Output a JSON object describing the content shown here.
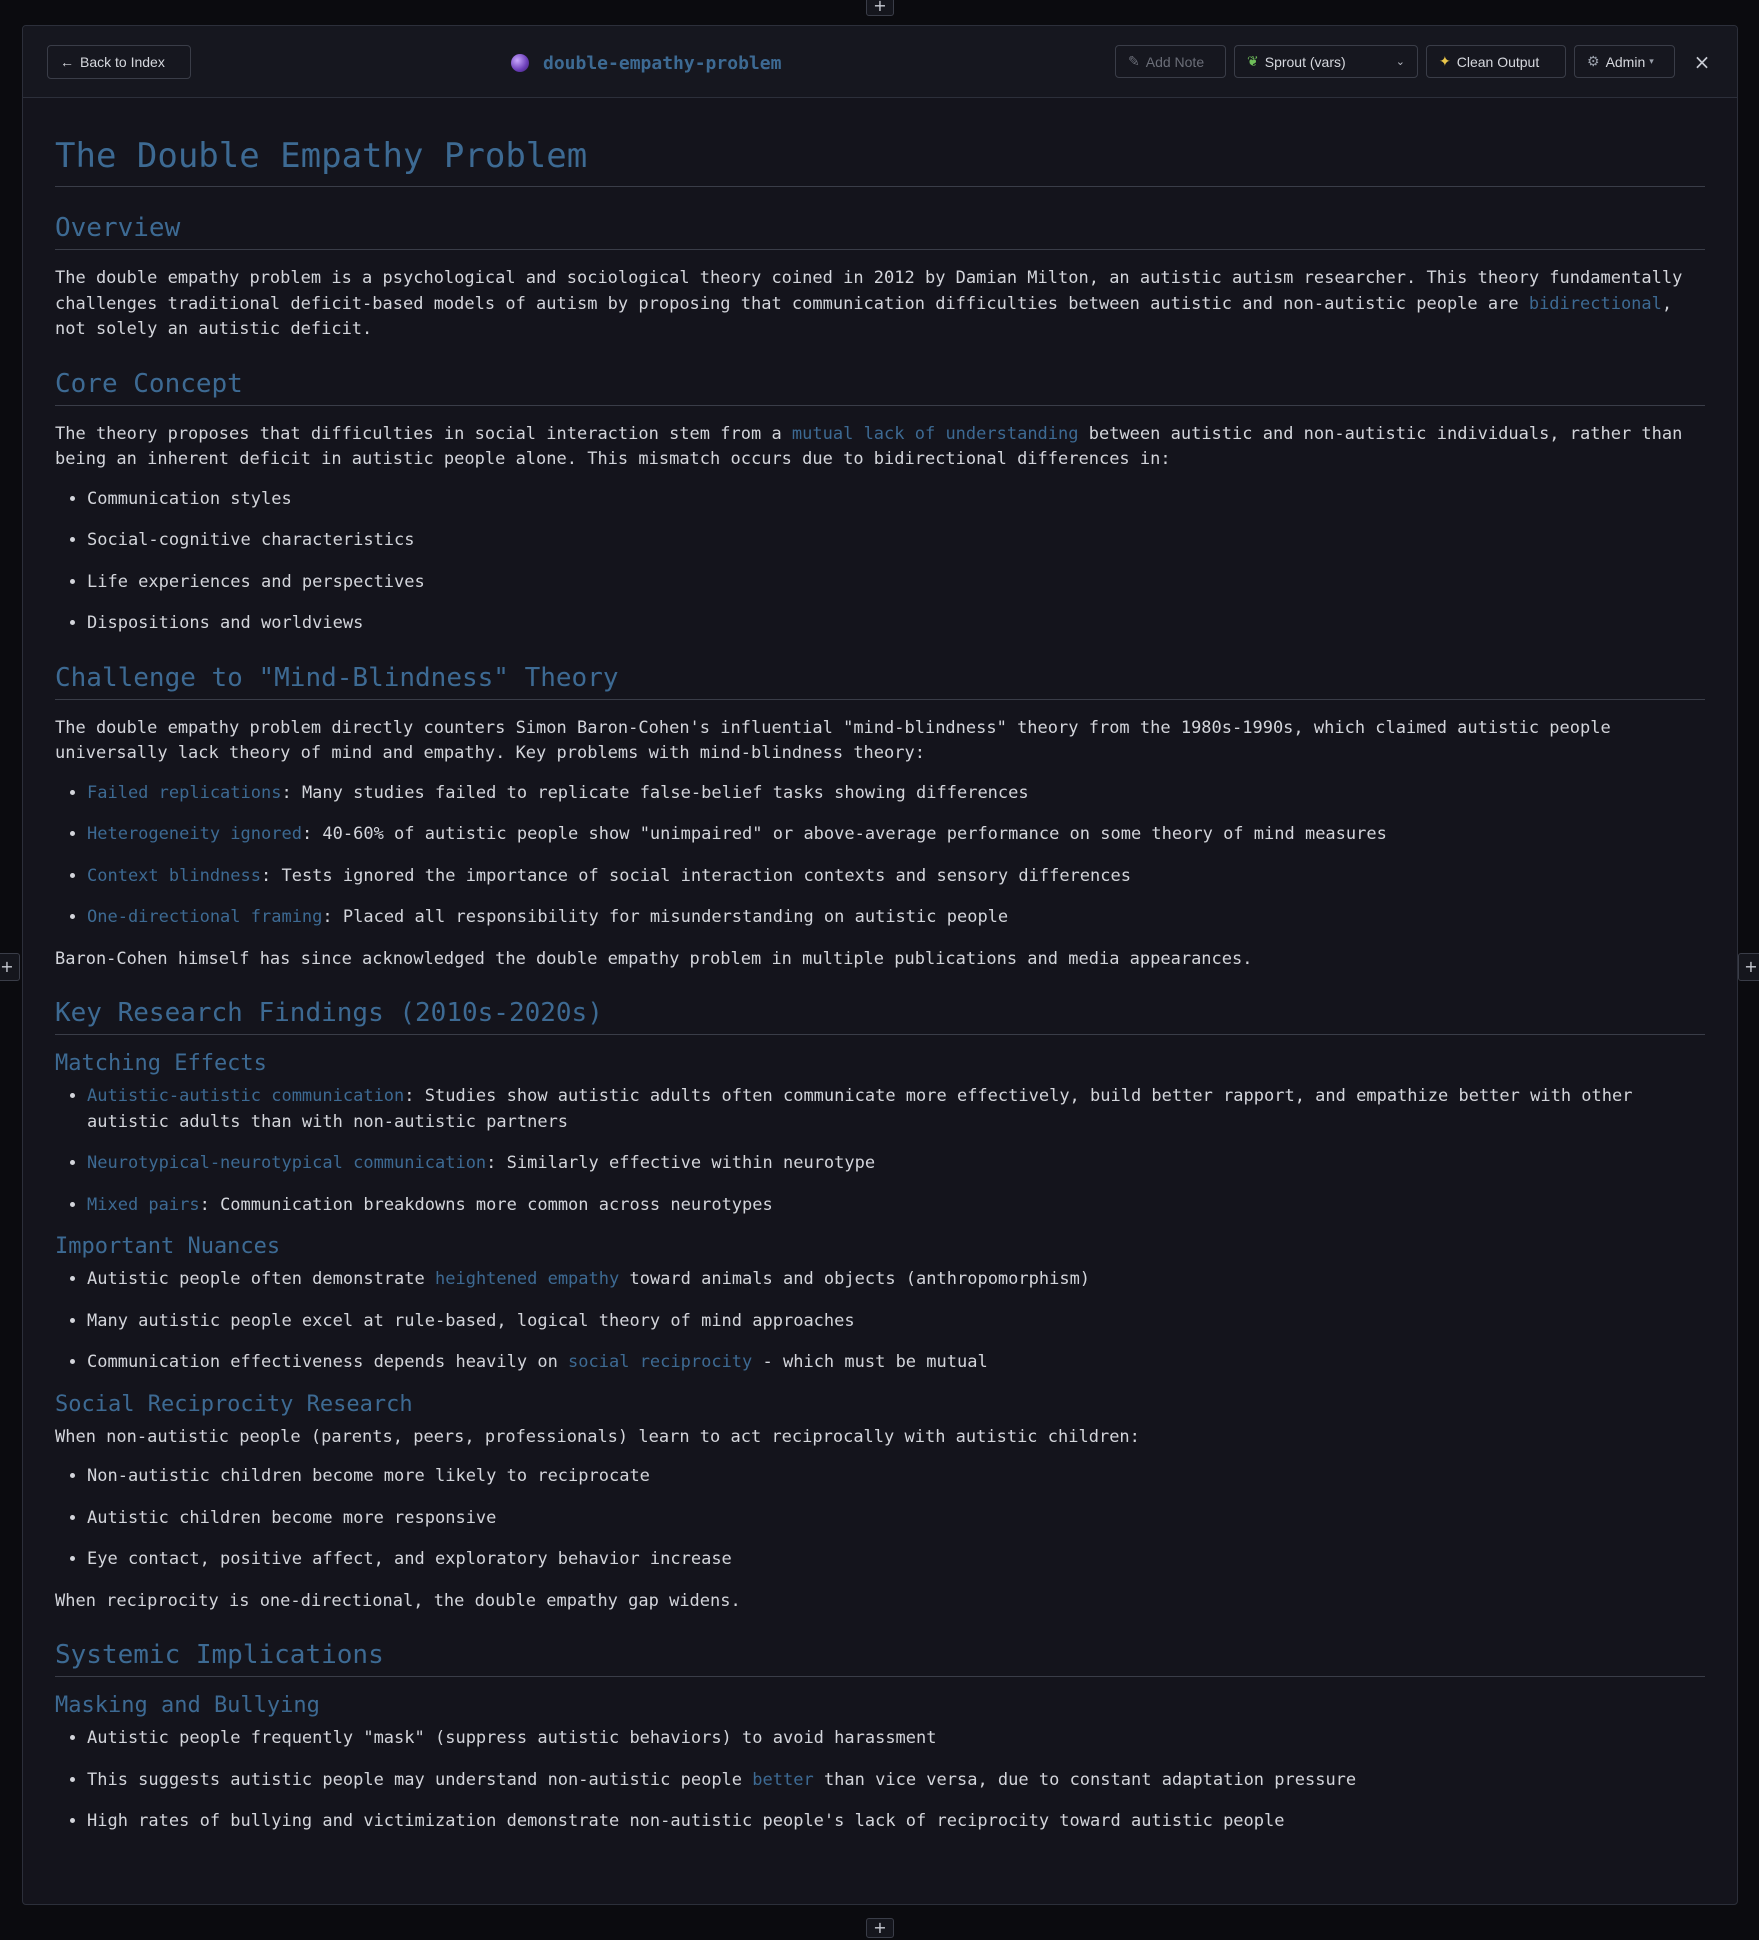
{
  "header": {
    "back_label": "Back to Index",
    "doc_title": "double-empathy-problem",
    "add_note_label": "Add Note",
    "sprout_value": "Sprout (vars)",
    "clean_label": "Clean Output",
    "admin_label": "Admin",
    "close_label": "×"
  },
  "icons": {
    "back": "arrow-left-icon",
    "orb": "crystal-ball-icon",
    "note": "memo-icon",
    "sprout": "seedling-icon",
    "clean": "sparkles-icon",
    "admin": "gear-icon"
  },
  "colors": {
    "background": "#14141c",
    "accent": "#3d6a93",
    "text": "#d3d5db"
  },
  "doc": {
    "h1": "The Double Empathy Problem",
    "overview": {
      "heading": "Overview",
      "p1_a": "The double empathy problem is a psychological and sociological theory coined in 2012 by Damian Milton, an autistic autism researcher. This theory fundamentally challenges traditional deficit-based models of autism by proposing that communication difficulties between autistic and non-autistic people are ",
      "p1_hl": "bidirectional",
      "p1_b": ", not solely an autistic deficit."
    },
    "core": {
      "heading": "Core Concept",
      "p1_a": "The theory proposes that difficulties in social interaction stem from a ",
      "p1_hl": "mutual lack of understanding",
      "p1_b": " between autistic and non-autistic individuals, rather than being an inherent deficit in autistic people alone. This mismatch occurs due to bidirectional differences in:",
      "items": [
        "Communication styles",
        "Social-cognitive characteristics",
        "Life experiences and perspectives",
        "Dispositions and worldviews"
      ]
    },
    "challenge": {
      "heading": "Challenge to \"Mind-Blindness\" Theory",
      "p1": "The double empathy problem directly counters Simon Baron-Cohen's influential \"mind-blindness\" theory from the 1980s-1990s, which claimed autistic people universally lack theory of mind and empathy. Key problems with mind-blindness theory:",
      "items": [
        {
          "term": "Failed replications",
          "text": ": Many studies failed to replicate false-belief tasks showing differences"
        },
        {
          "term": "Heterogeneity ignored",
          "text": ": 40-60% of autistic people show \"unimpaired\" or above-average performance on some theory of mind measures"
        },
        {
          "term": "Context blindness",
          "text": ": Tests ignored the importance of social interaction contexts and sensory differences"
        },
        {
          "term": "One-directional framing",
          "text": ": Placed all responsibility for misunderstanding on autistic people"
        }
      ],
      "p2": "Baron-Cohen himself has since acknowledged the double empathy problem in multiple publications and media appearances."
    },
    "research": {
      "heading": "Key Research Findings (2010s-2020s)",
      "matching": {
        "heading": "Matching Effects",
        "items": [
          {
            "term": "Autistic-autistic communication",
            "text": ": Studies show autistic adults often communicate more effectively, build better rapport, and empathize better with other autistic adults than with non-autistic partners"
          },
          {
            "term": "Neurotypical-neurotypical communication",
            "text": ": Similarly effective within neurotype"
          },
          {
            "term": "Mixed pairs",
            "text": ": Communication breakdowns more common across neurotypes"
          }
        ]
      },
      "nuances": {
        "heading": "Important Nuances",
        "i1_a": "Autistic people often demonstrate ",
        "i1_hl": "heightened empathy",
        "i1_b": " toward animals and objects (anthropomorphism)",
        "i2": "Many autistic people excel at rule-based, logical theory of mind approaches",
        "i3_a": "Communication effectiveness depends heavily on ",
        "i3_hl": "social reciprocity",
        "i3_b": " - which must be mutual"
      },
      "reciprocity": {
        "heading": "Social Reciprocity Research",
        "p1": "When non-autistic people (parents, peers, professionals) learn to act reciprocally with autistic children:",
        "items": [
          "Non-autistic children become more likely to reciprocate",
          "Autistic children become more responsive",
          "Eye contact, positive affect, and exploratory behavior increase"
        ],
        "p2": "When reciprocity is one-directional, the double empathy gap widens."
      }
    },
    "systemic": {
      "heading": "Systemic Implications",
      "masking": {
        "heading": "Masking and Bullying",
        "i1": "Autistic people frequently \"mask\" (suppress autistic behaviors) to avoid harassment",
        "i2_a": "This suggests autistic people may understand non-autistic people ",
        "i2_hl": "better",
        "i2_b": " than vice versa, due to constant adaptation pressure",
        "i3": "High rates of bullying and victimization demonstrate non-autistic people's lack of reciprocity toward autistic people"
      }
    }
  }
}
